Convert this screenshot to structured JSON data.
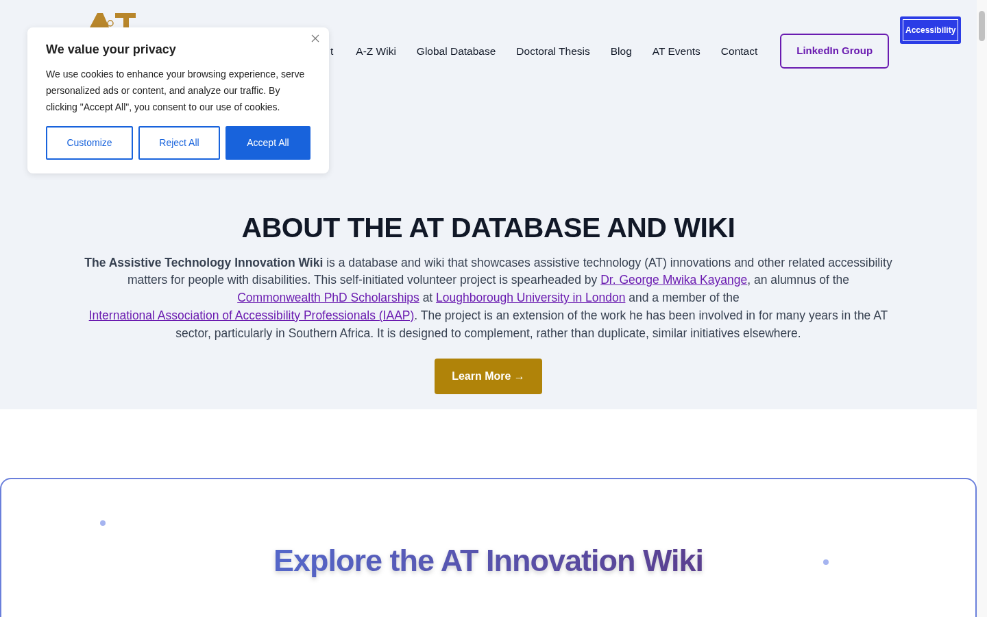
{
  "nav": {
    "items": [
      {
        "label": "t"
      },
      {
        "label": "A-Z Wiki"
      },
      {
        "label": "Global Database"
      },
      {
        "label": "Doctoral Thesis"
      },
      {
        "label": "Blog"
      },
      {
        "label": "AT Events"
      },
      {
        "label": "Contact"
      }
    ],
    "cta": "LinkedIn Group",
    "accessibility": "Accessibility"
  },
  "cookie_dialog": {
    "title": "We value your privacy",
    "text": "We use cookies to enhance your browsing experience, serve personalized ads or content, and analyze our traffic. By clicking \"Accept All\", you consent to our use of cookies.",
    "buttons": [
      {
        "label": "Customize",
        "kind": "outline"
      },
      {
        "label": "Reject All",
        "kind": "outline"
      },
      {
        "label": "Accept All",
        "kind": "primary"
      }
    ]
  },
  "about": {
    "title": "ABOUT THE AT DATABASE AND WIKI",
    "paragraph": [
      {
        "kind": "bold",
        "text": "The Assistive Technology Innovation Wiki"
      },
      {
        "kind": "text",
        "text": " is a database and wiki that showcases assistive technology (AT) innovations and other related accessibility matters for people with disabilities. This self-initiated volunteer project is spearheaded by "
      },
      {
        "kind": "link",
        "text": "Dr. George Mwika Kayange"
      },
      {
        "kind": "text",
        "text": ", an alumnus of the "
      },
      {
        "kind": "link",
        "text": "Commonwealth PhD Scholarships"
      },
      {
        "kind": "text",
        "text": " at "
      },
      {
        "kind": "link",
        "text": "Loughborough University in London"
      },
      {
        "kind": "text",
        "text": " and a member of the "
      },
      {
        "kind": "link",
        "text": "International Association of Accessibility Professionals (IAAP)"
      },
      {
        "kind": "text",
        "text": ". The project is an extension of the work he has been involved in for many years in the AT sector, particularly in Southern Africa. It is designed to complement, rather than duplicate, similar initiatives elsewhere."
      }
    ],
    "button": "Learn More →"
  },
  "explore": {
    "title": "Explore the AT Innovation Wiki"
  }
}
